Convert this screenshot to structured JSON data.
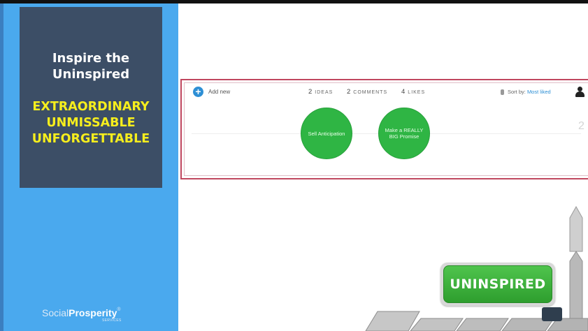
{
  "slide": {
    "title": "Inspire the Uninspired",
    "tags": [
      "EXTRAORDINARY",
      "UNMISSABLE",
      "UNFORGETTABLE"
    ],
    "brand": {
      "part1": "Social",
      "part2": "Prosperity",
      "mark": "®",
      "sub": "SERVICES"
    },
    "badge": "UNINSPIRED"
  },
  "board": {
    "add_label": "Add new",
    "stats": [
      {
        "count": "2",
        "label": "IDEAS"
      },
      {
        "count": "2",
        "label": "COMMENTS"
      },
      {
        "count": "4",
        "label": "LIKES"
      }
    ],
    "sort_label": "Sort by:",
    "sort_value": "Most liked",
    "ideas": [
      {
        "text": "Sell Anticipation"
      },
      {
        "text": "Make a REALLY BIG Promise"
      }
    ],
    "column_number": "2"
  },
  "colors": {
    "accent_blue": "#4aa9ee",
    "panel_navy": "#3c4e66",
    "tag_yellow": "#f6ee1d",
    "idea_green": "#2fb544",
    "highlight_border": "#c0475f"
  },
  "icons": [
    "add-icon",
    "microphone-icon",
    "user-icon",
    "up-arrow-icon",
    "chevron-left-icon"
  ]
}
